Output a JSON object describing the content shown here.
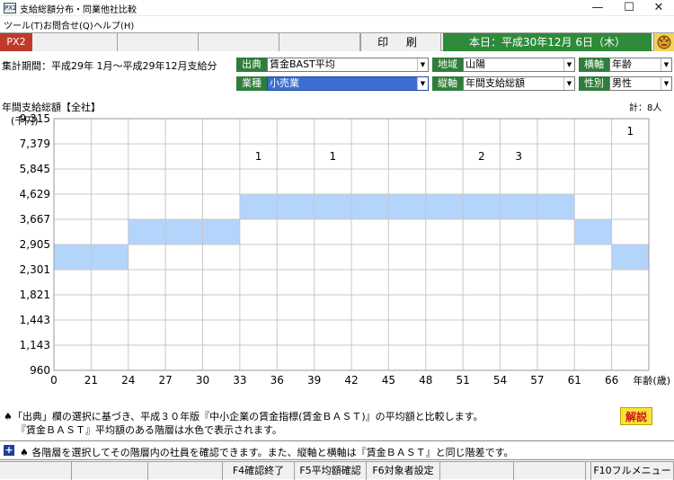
{
  "window": {
    "icon_text": "PX2",
    "title": "支給総額分布・同業他社比較"
  },
  "menu": [
    "ツール(T)",
    "お問合せ(Q)",
    "ヘルプ(H)"
  ],
  "strip": {
    "app_code": "PX2",
    "print_label": "印 刷",
    "date_text": "本日：平成30年12月 6日（木）"
  },
  "filters": {
    "period": "集計期間：平成29年 1月～平成29年12月支給分",
    "source_label": "出典",
    "source_value": "賃金BAST平均",
    "region_label": "地域",
    "region_value": "山陽",
    "haxis_label": "横軸",
    "haxis_value": "年齢",
    "industry_label": "業種",
    "industry_value": "小売業",
    "vaxis_label": "縦軸",
    "vaxis_value": "年間支給総額",
    "gender_label": "性別",
    "gender_value": "男性"
  },
  "chart_data": {
    "type": "heatmap",
    "title": "年間支給総額【全社】",
    "total_label": "計：8人",
    "ylabel": "(千円)",
    "xlabel": "年齢(歳)",
    "x_ticks": [
      0,
      21,
      24,
      27,
      30,
      33,
      36,
      39,
      42,
      45,
      48,
      51,
      54,
      57,
      61,
      66
    ],
    "y_ticks": [
      960,
      1143,
      1443,
      1821,
      2301,
      2905,
      3667,
      4629,
      5845,
      7379,
      9315
    ],
    "bast_average_band": [
      {
        "age_from": 0,
        "age_to": 24,
        "y_from": 2301,
        "y_to": 2905
      },
      {
        "age_from": 24,
        "age_to": 33,
        "y_from": 2905,
        "y_to": 3667
      },
      {
        "age_from": 33,
        "age_to": 61,
        "y_from": 3667,
        "y_to": 4629
      },
      {
        "age_from": 61,
        "age_to": 66,
        "y_from": 2905,
        "y_to": 3667
      },
      {
        "age_from": 66,
        "age_to": 70,
        "y_from": 2301,
        "y_to": 2905
      }
    ],
    "employee_counts": [
      {
        "age_band": "33-36",
        "salary_band": "5845-7379",
        "count": 1
      },
      {
        "age_band": "39-42",
        "salary_band": "5845-7379",
        "count": 1
      },
      {
        "age_band": "51-54",
        "salary_band": "5845-7379",
        "count": 2
      },
      {
        "age_band": "54-57",
        "salary_band": "5845-7379",
        "count": 3
      },
      {
        "age_band": "66+",
        "salary_band": "7379-9315",
        "count": 1
      }
    ]
  },
  "notes": {
    "line1": "♠「出典」欄の選択に基づき、平成３０年版『中小企業の賃金指標(賃金ＢＡＳＴ)』の平均額と比較します。",
    "line2": "『賃金ＢＡＳＴ』平均額のある階層は水色で表示されます。",
    "help_button": "解説"
  },
  "info_bar": "♠ 各階層を選択してその階層内の社員を確認できます。また、縦軸と横軸は『賃金ＢＡＳＴ』と同じ階差です。",
  "function_keys": [
    "",
    "",
    "",
    "F4確認終了",
    "F5平均額確認",
    "F6対象者設定",
    "",
    "",
    "",
    "F10フルメニュー"
  ],
  "colors": {
    "band_fill": "#b3d4fb",
    "green_label": "#2f7d3a",
    "date_banner": "#2e8b3a",
    "px2_red": "#c0392b"
  }
}
